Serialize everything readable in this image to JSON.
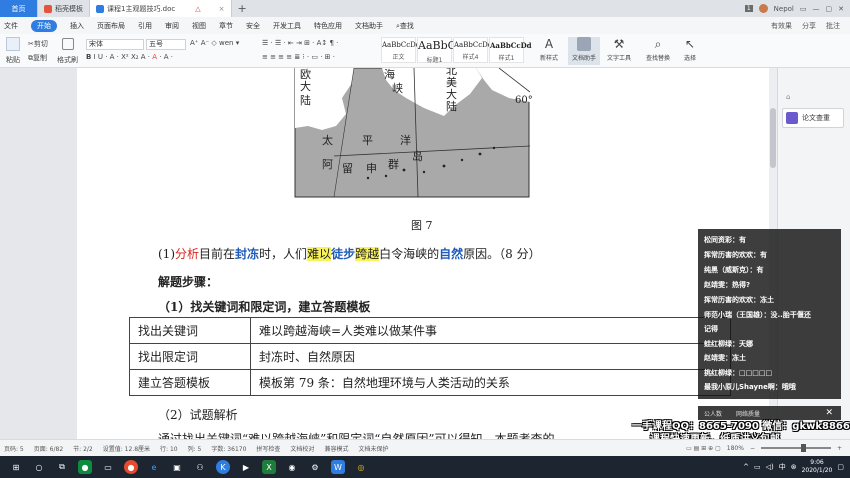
{
  "tabs": {
    "home": "首页",
    "template": "稻壳模板",
    "doc": "课程1主观题技巧.doc",
    "plus": "+"
  },
  "window": {
    "badge": "1",
    "user": "Nepol"
  },
  "menu": {
    "items": [
      "文件",
      "开始",
      "插入",
      "页面布局",
      "引用",
      "审阅",
      "视图",
      "章节",
      "安全",
      "开发工具",
      "特色应用",
      "文档助手",
      "查找"
    ],
    "right": [
      "有效果",
      "分享",
      "批注"
    ]
  },
  "ribbon": {
    "paste": "粘贴",
    "cut": "剪切",
    "copy": "复制",
    "format_painter": "格式刷",
    "font": "宋体",
    "size": "五号",
    "styles": [
      {
        "sample": "AaBbCcDd",
        "label": "正文"
      },
      {
        "sample": "AaBbC",
        "label": "标题1"
      },
      {
        "sample": "AaBbCcDd",
        "label": "样式4"
      },
      {
        "sample": "AaBbCcDd",
        "label": "样式1"
      }
    ],
    "tools": [
      "新样式",
      "文档助手",
      "文字工具",
      "查找替换",
      "选择"
    ]
  },
  "map": {
    "labels": [
      "欧",
      "大",
      "陆",
      "海",
      "峡",
      "北",
      "美",
      "大",
      "陆",
      "太",
      "平",
      "洋",
      "阿",
      "留",
      "申",
      "群",
      "岛"
    ],
    "lat": "60°"
  },
  "doc": {
    "figure": "图 7",
    "question": {
      "num": "(1)",
      "w1": "分析",
      "w2": "目前在",
      "w3": "封冻",
      "w4": "时，人们",
      "w5": "难以",
      "w6": "徒步",
      "w7": "跨越",
      "w8": "白令海峡的",
      "w9": "自然",
      "w10": "原因。（8 分）"
    },
    "steps_heading": "解题步骤：",
    "sub1": "（1）找关键词和限定词，建立答题模板",
    "table": [
      [
        "找出关键词",
        "难以跨越海峡=人类难以做某件事"
      ],
      [
        "找出限定词",
        "封冻时、自然原因"
      ],
      [
        "建立答题模板",
        "模板第 79 条：自然地理环境与人类活动的关系"
      ]
    ],
    "sub2": "（2）试题解析",
    "body": "通过找出关键词“难以跨越海峡”和限定词“自然原因”可以得知，本题考查的"
  },
  "sidepanel": {
    "top": "⌂",
    "button": "论文查重"
  },
  "chat": [
    "松同资彩：有",
    "挥常历害的欢欢：有",
    "纯黑（威斯克）：有",
    "赵靖雯：热得?",
    "挥常历害的欢欢：冻土",
    "师范小瑞（王国雄）：没..胎干偃还",
    "记得",
    "蛙红柳绿：天娜",
    "赵靖雯：冻土",
    "挑红柳绿：□□□□□",
    "最我小原儿Shayne啊：哦哦"
  ],
  "chat_bottom": {
    "a": "公人数",
    "b": "网络质量"
  },
  "promo": [
    "一手课程QQ：8665-7090 微信：gkwk8866",
    "课程快速更新，纸质讲义包邮"
  ],
  "status": {
    "items": [
      "页码: 5",
      "页面: 6/82",
      "节: 2/2",
      "设置值: 12.8厘米",
      "行: 10",
      "列: 5",
      "字数: 36170",
      "拼写检查",
      "文档校对",
      "兼容模式",
      "文档未保护"
    ],
    "zoom": "180%"
  },
  "clock": {
    "time": "9:06",
    "date": "2020/1/20"
  },
  "colors": {
    "accent": "#2f7de1",
    "highlight": "#f9f35a",
    "red": "#d8261c",
    "blue": "#1f5ab8"
  }
}
